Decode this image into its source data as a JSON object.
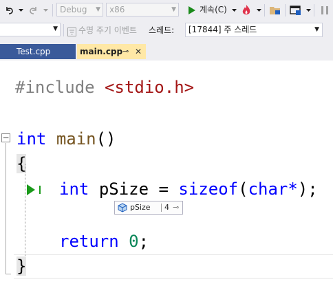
{
  "toolbar": {
    "config_combo": "Debug",
    "platform_combo": "x86",
    "continue_label": "계속(C)"
  },
  "location_bar": {
    "lifecycle_label": "수명 주기 이벤트",
    "thread_label": "스레드:",
    "thread_value": "[17844] 주 스레드"
  },
  "tabs": [
    {
      "label": "Test.cpp",
      "active": false
    },
    {
      "label": "main.cpp",
      "active": true
    }
  ],
  "tab_pin_glyph": "⊸",
  "tab_close_glyph": "✕",
  "code": {
    "line1": {
      "directive": "#include",
      "header": "<stdio.h>"
    },
    "line3": {
      "type": "int",
      "name": "main",
      "parens": "()"
    },
    "line4": "{",
    "line5": {
      "type": "int",
      "var": "pSize",
      "op": "=",
      "func": "sizeof",
      "open": "(",
      "arg": "char*",
      "close": ");"
    },
    "line7": {
      "keyword": "return",
      "value": "0",
      "semi": ";"
    },
    "line8": "}"
  },
  "datatip": {
    "name": "pSize",
    "value": "4"
  },
  "icons": {
    "undo": "undo-icon",
    "redo": "redo-icon",
    "continue": "play-icon",
    "hot_reload": "flame-icon",
    "collapse": "minus-box-icon",
    "exec_pointer": "current-statement-arrow-icon",
    "variable": "variable-icon"
  },
  "colors": {
    "keyword": "#0000ff",
    "function": "#74531f",
    "string": "#a31515",
    "number": "#098658",
    "active_tab": "#ffe8a6",
    "inactive_tab": "#3a5a9a",
    "run_green": "#1a8a1a"
  }
}
